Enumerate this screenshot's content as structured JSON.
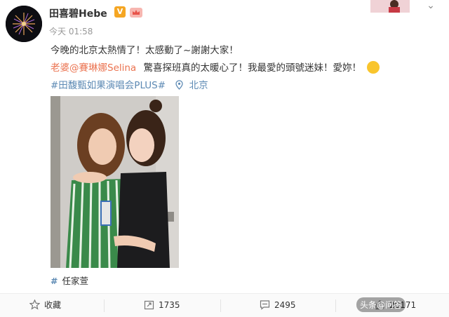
{
  "header": {
    "username": "田喜碧Hebe",
    "verified_badge": "V",
    "member_badge": "crown-icon",
    "timestamp": "今天 01:58"
  },
  "post": {
    "line1": "今晚的北京太熱情了！太感動了~謝謝大家！",
    "line2_mention": "老婆@賽琳娜Selina",
    "line2_rest": "驚喜探班真的太暖心了！我最愛的頭號迷妹！愛妳！",
    "hashtag": "#田馥甄如果演唱会PLUS#",
    "location": "北京",
    "photo_tag": "任家萱"
  },
  "actions": {
    "favorite_label": "收藏",
    "repost_count": "1735",
    "comment_count": "2495",
    "like_count": "20171"
  },
  "colors": {
    "accent_link": "#eb7350",
    "hashtag_blue": "#5d8ab4",
    "verified_gold": "#f5a623"
  },
  "watermark": "头条@问答"
}
